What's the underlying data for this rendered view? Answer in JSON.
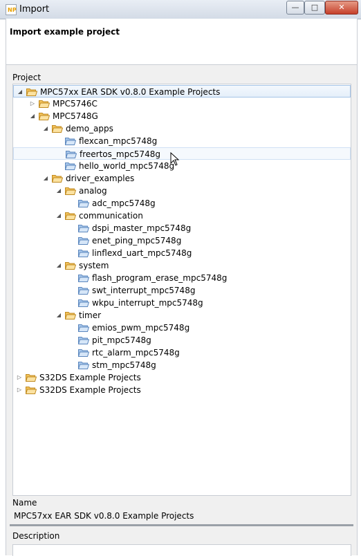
{
  "window": {
    "title": "Import",
    "app_icon_text": "NP",
    "controls": {
      "minimize": "—",
      "maximize": "□",
      "close": "✕"
    }
  },
  "header": {
    "title": "Import example project"
  },
  "project": {
    "label": "Project",
    "tree": [
      {
        "label": "MPC57xx EAR SDK v0.8.0 Example Projects",
        "depth": 0,
        "twisty": "expanded",
        "folder": "open",
        "selected": true
      },
      {
        "label": "MPC5746C",
        "depth": 1,
        "twisty": "collapsed",
        "folder": "open"
      },
      {
        "label": "MPC5748G",
        "depth": 1,
        "twisty": "expanded",
        "folder": "open"
      },
      {
        "label": "demo_apps",
        "depth": 2,
        "twisty": "expanded",
        "folder": "open"
      },
      {
        "label": "flexcan_mpc5748g",
        "depth": 3,
        "twisty": "none",
        "folder": "project"
      },
      {
        "label": "freertos_mpc5748g",
        "depth": 3,
        "twisty": "none",
        "folder": "project",
        "hover": true
      },
      {
        "label": "hello_world_mpc5748g",
        "depth": 3,
        "twisty": "none",
        "folder": "project"
      },
      {
        "label": "driver_examples",
        "depth": 2,
        "twisty": "expanded",
        "folder": "open"
      },
      {
        "label": "analog",
        "depth": 3,
        "twisty": "expanded",
        "folder": "open"
      },
      {
        "label": "adc_mpc5748g",
        "depth": 4,
        "twisty": "none",
        "folder": "project"
      },
      {
        "label": "communication",
        "depth": 3,
        "twisty": "expanded",
        "folder": "open"
      },
      {
        "label": "dspi_master_mpc5748g",
        "depth": 4,
        "twisty": "none",
        "folder": "project"
      },
      {
        "label": "enet_ping_mpc5748g",
        "depth": 4,
        "twisty": "none",
        "folder": "project"
      },
      {
        "label": "linflexd_uart_mpc5748g",
        "depth": 4,
        "twisty": "none",
        "folder": "project"
      },
      {
        "label": "system",
        "depth": 3,
        "twisty": "expanded",
        "folder": "open"
      },
      {
        "label": "flash_program_erase_mpc5748g",
        "depth": 4,
        "twisty": "none",
        "folder": "project"
      },
      {
        "label": "swt_interrupt_mpc5748g",
        "depth": 4,
        "twisty": "none",
        "folder": "project"
      },
      {
        "label": "wkpu_interrupt_mpc5748g",
        "depth": 4,
        "twisty": "none",
        "folder": "project"
      },
      {
        "label": "timer",
        "depth": 3,
        "twisty": "expanded",
        "folder": "open"
      },
      {
        "label": "emios_pwm_mpc5748g",
        "depth": 4,
        "twisty": "none",
        "folder": "project"
      },
      {
        "label": "pit_mpc5748g",
        "depth": 4,
        "twisty": "none",
        "folder": "project"
      },
      {
        "label": "rtc_alarm_mpc5748g",
        "depth": 4,
        "twisty": "none",
        "folder": "project"
      },
      {
        "label": "stm_mpc5748g",
        "depth": 4,
        "twisty": "none",
        "folder": "project"
      },
      {
        "label": "S32DS Example Projects",
        "depth": 0,
        "twisty": "collapsed",
        "folder": "open"
      },
      {
        "label": "S32DS Example Projects",
        "depth": 0,
        "twisty": "collapsed",
        "folder": "open"
      }
    ]
  },
  "name": {
    "label": "Name",
    "value": "MPC57xx EAR SDK v0.8.0 Example Projects"
  },
  "description": {
    "label": "Description",
    "value": ""
  },
  "colors": {
    "folder": "#f2c25b",
    "project_folder": "#a9c8ec",
    "selection": "#e5effa"
  }
}
